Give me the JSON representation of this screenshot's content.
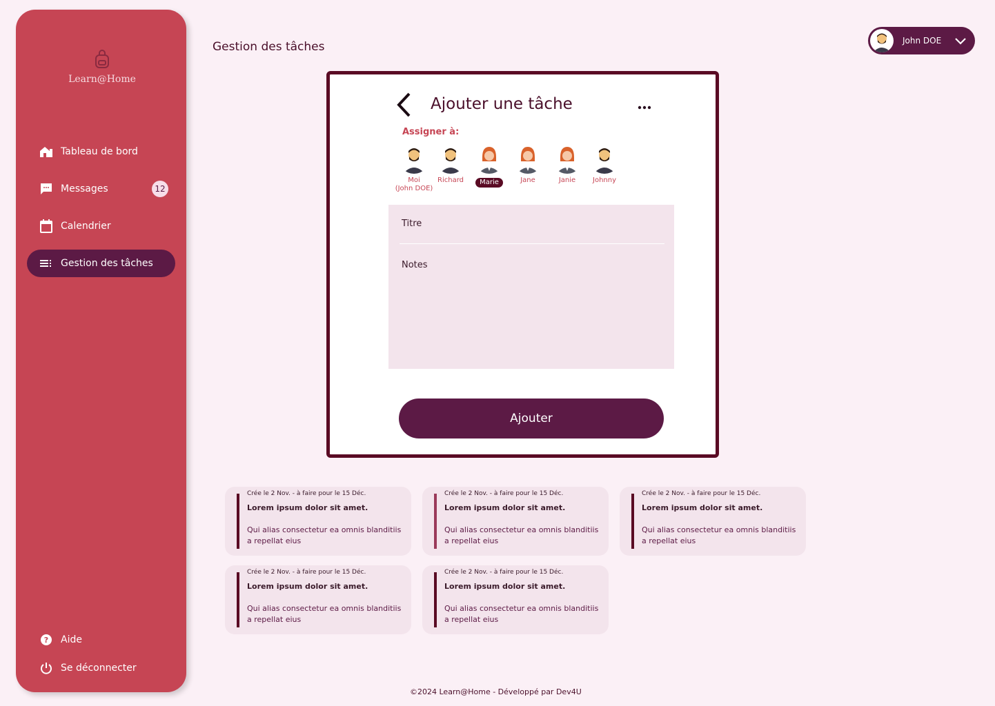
{
  "app": {
    "logo_text": "Learn@Home"
  },
  "sidebar": {
    "items": [
      {
        "label": "Tableau de bord",
        "icon": "home-icon"
      },
      {
        "label": "Messages",
        "icon": "message-icon",
        "badge": "12"
      },
      {
        "label": "Calendrier",
        "icon": "calendar-icon"
      },
      {
        "label": "Gestion des tâches",
        "icon": "tasks-icon",
        "active": true
      }
    ],
    "bottom": [
      {
        "label": "Aide",
        "icon": "help-icon"
      },
      {
        "label": "Se déconnecter",
        "icon": "power-icon"
      }
    ]
  },
  "header": {
    "title": "Gestion des tâches",
    "user_name": "John DOE"
  },
  "modal": {
    "title": "Ajouter une tâche",
    "assign_label": "Assigner à:",
    "assignees": [
      {
        "label": "Moi",
        "sub": "(John DOE)"
      },
      {
        "label": "Richard"
      },
      {
        "label": "Marie",
        "selected": true
      },
      {
        "label": "Jane"
      },
      {
        "label": "Janie"
      },
      {
        "label": "Johnny"
      }
    ],
    "title_placeholder": "Titre",
    "notes_placeholder": "Notes",
    "submit_label": "Ajouter"
  },
  "tasks": [
    {
      "meta": "Crée le 2 Nov. - à faire pour le 15 Déc.",
      "title": "Lorem ipsum dolor sit amet.",
      "desc": "Qui alias consectetur ea omnis blanditiis a  repellat eius"
    },
    {
      "meta": "Crée le 2 Nov. - à faire pour le 15 Déc.",
      "title": "Lorem ipsum dolor sit amet.",
      "desc": "Qui alias consectetur ea omnis blanditiis a  repellat eius"
    },
    {
      "meta": "Crée le 2 Nov. - à faire pour le 15 Déc.",
      "title": "Lorem ipsum dolor sit amet.",
      "desc": "Qui alias consectetur ea omnis blanditiis a  repellat eius"
    },
    {
      "meta": "Crée le 2 Nov. - à faire pour le 15 Déc.",
      "title": "Lorem ipsum dolor sit amet.",
      "desc": "Qui alias consectetur ea omnis blanditiis a  repellat eius"
    },
    {
      "meta": "Crée le 2 Nov. - à faire pour le 15 Déc.",
      "title": "Lorem ipsum dolor sit amet.",
      "desc": "Qui alias consectetur ea omnis blanditiis a  repellat eius"
    }
  ],
  "footer": {
    "text": "©2024 Learn@Home - Développé par Dev4U"
  },
  "colors": {
    "sidebar": "#c64554",
    "primary": "#5c1a45",
    "border": "#5a0b24",
    "background": "#fbf0f6"
  }
}
